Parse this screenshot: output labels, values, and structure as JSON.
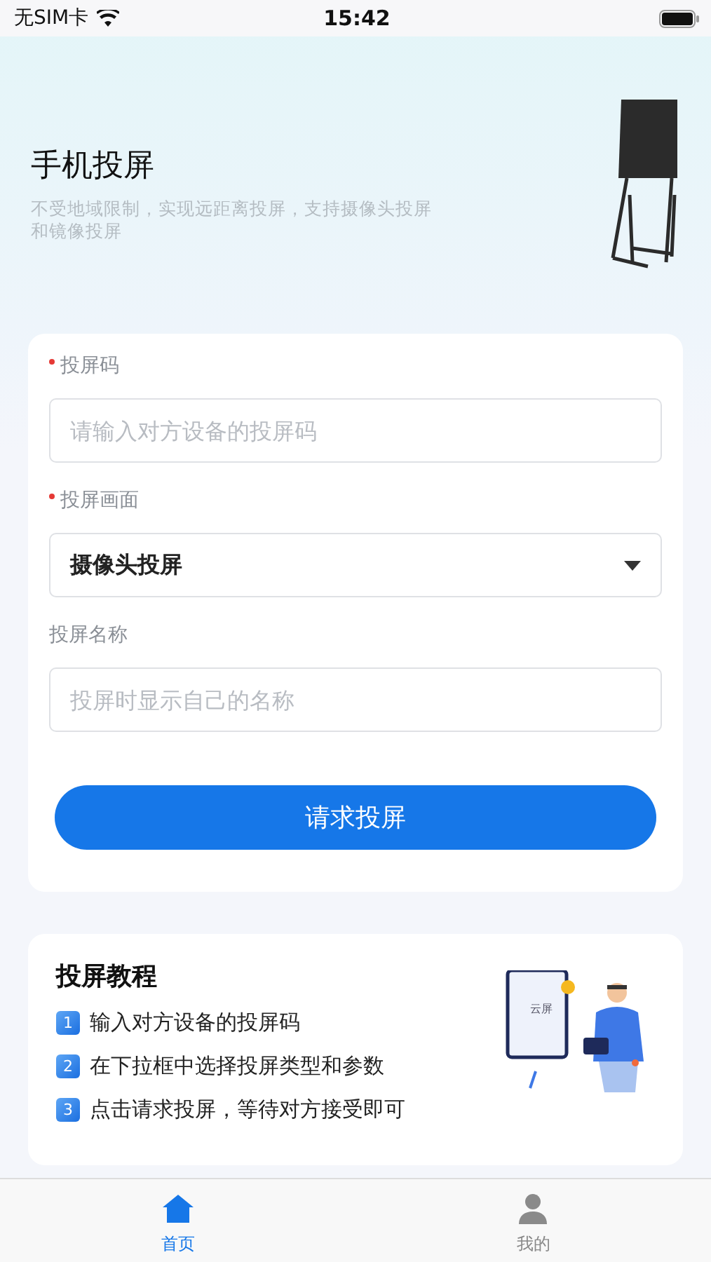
{
  "status_bar": {
    "carrier": "无SIM卡",
    "time": "15:42"
  },
  "hero": {
    "title": "手机投屏",
    "subtitle": "不受地域限制，实现远距离投屏，支持摄像头投屏和镜像投屏"
  },
  "form": {
    "fields": [
      {
        "kind": "input",
        "label": "投屏码",
        "required": true,
        "placeholder": "请输入对方设备的投屏码"
      },
      {
        "kind": "select",
        "label": "投屏画面",
        "required": true,
        "value": "摄像头投屏"
      },
      {
        "kind": "input",
        "label": "投屏名称",
        "required": false,
        "placeholder": "投屏时显示自己的名称"
      }
    ],
    "submit": "请求投屏"
  },
  "tutorial": {
    "title": "投屏教程",
    "steps": [
      {
        "number": "1",
        "text": "输入对方设备的投屏码"
      },
      {
        "number": "2",
        "text": "在下拉框中选择投屏类型和参数"
      },
      {
        "number": "3",
        "text": "点击请求投屏，等待对方接受即可"
      }
    ],
    "illustration_label": "云屏"
  },
  "tab_bar": [
    {
      "label": "首页",
      "selected": true
    },
    {
      "label": "我的",
      "selected": false
    }
  ]
}
